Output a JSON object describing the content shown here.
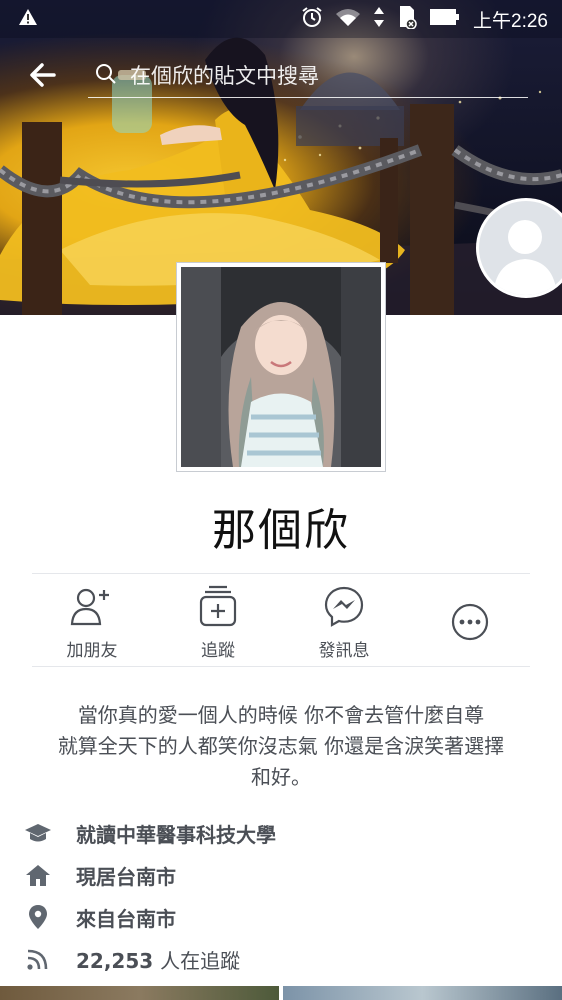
{
  "status_bar": {
    "time": "上午2:26",
    "icons": [
      "warning-icon",
      "alarm-icon",
      "wifi-icon",
      "data-arrows-icon",
      "sd-card-icon",
      "battery-icon"
    ]
  },
  "header": {
    "search_placeholder": "在個欣的貼文中搜尋",
    "back_icon": "back-arrow-icon"
  },
  "profile": {
    "name": "那個欣"
  },
  "actions": [
    {
      "id": "add-friend",
      "label": "加朋友",
      "icon": "add-friend-icon"
    },
    {
      "id": "follow",
      "label": "追蹤",
      "icon": "follow-icon"
    },
    {
      "id": "message",
      "label": "發訊息",
      "icon": "messenger-icon"
    },
    {
      "id": "more",
      "label": "",
      "icon": "more-icon"
    }
  ],
  "bio": {
    "lines": [
      "當你真的愛一個人的時候 你不會去管什麼自尊",
      "就算全天下的人都笑你沒志氣 你還是含淚笑著選擇",
      "和好。"
    ]
  },
  "info": {
    "education": "就讀中華醫事科技大學",
    "lives_in": "現居台南市",
    "from": "來自台南市",
    "followers_count": "22,253",
    "followers_suffix": "人在追蹤"
  },
  "colors": {
    "icon_gray": "#4b4f56",
    "info_icon_gray": "#606770",
    "divider": "#e5e7eb"
  }
}
